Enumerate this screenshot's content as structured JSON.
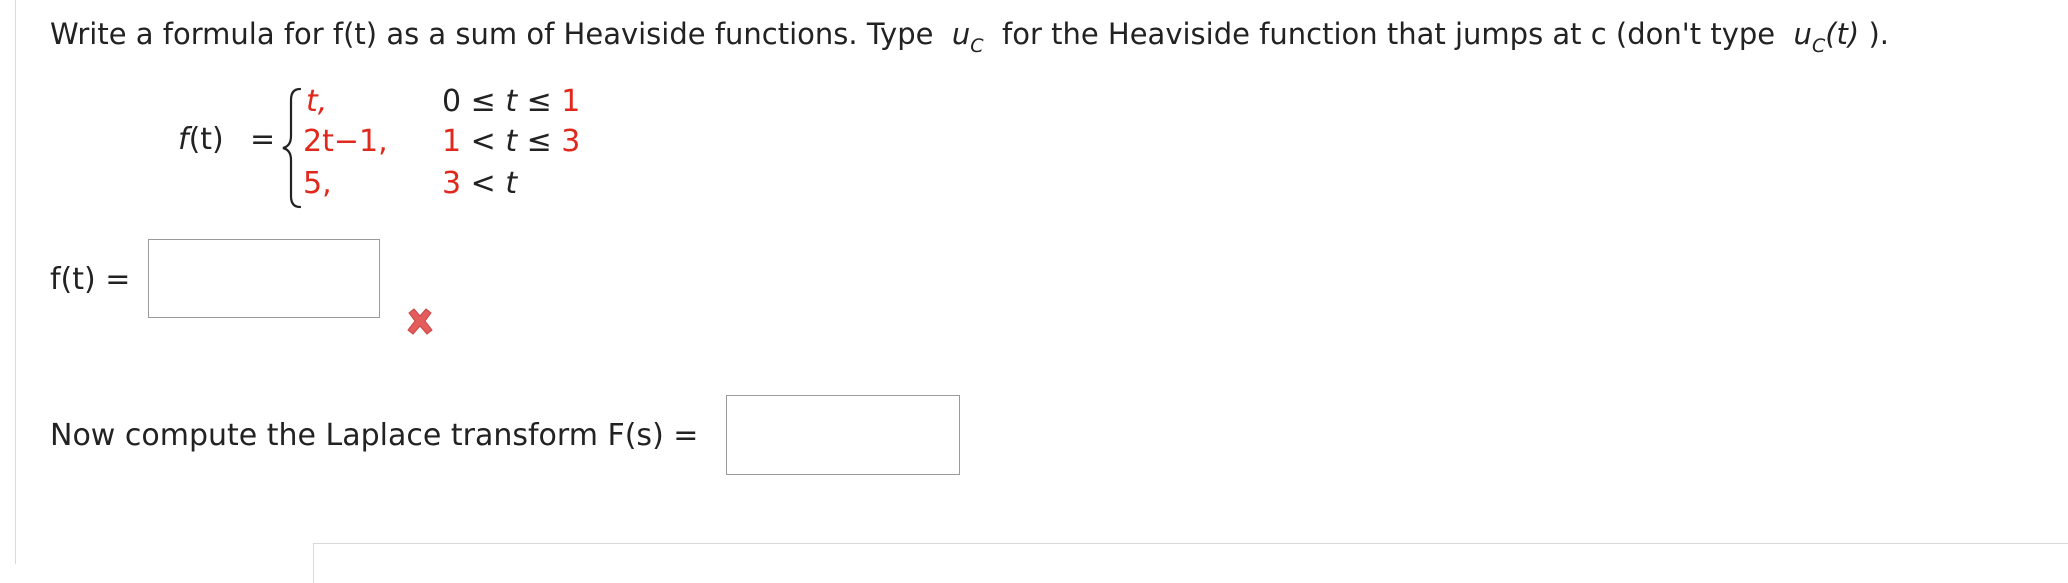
{
  "instructions": {
    "part1": "Write a formula for f(t) as a sum of Heaviside functions. Type",
    "uc_base": "u",
    "uc_sub": "C",
    "part2": "for the Heaviside function that jumps at c (don't type",
    "uct_base": "u",
    "uct_sub": "C",
    "uct_arg": "(t)",
    "part3": ")."
  },
  "piecewise": {
    "lhs_name": "f",
    "lhs_arg": "(t)",
    "equals": "=",
    "rows": [
      {
        "expr": "t,",
        "cond_left": "0",
        "cond_op1": " ≤ ",
        "cond_var": "t",
        "cond_op2": " ≤ ",
        "cond_right": "1"
      },
      {
        "expr": "2t−1,",
        "cond_left": "1",
        "cond_op1": " < ",
        "cond_var": "t",
        "cond_op2": " ≤ ",
        "cond_right": "3"
      },
      {
        "expr": "5,",
        "cond_left": "3",
        "cond_op1": " < ",
        "cond_var": "t",
        "cond_op2": "",
        "cond_right": ""
      }
    ]
  },
  "answer": {
    "label": "f(t)  =",
    "value": "",
    "status": "incorrect",
    "status_icon": "x-mark-icon",
    "status_color": "#e35d5d"
  },
  "laplace": {
    "label": "Now compute the Laplace transform F(s)  =",
    "value": ""
  },
  "colors": {
    "accent_red": "#e0281d",
    "text": "#222222",
    "input_border": "#9a9a9a"
  }
}
